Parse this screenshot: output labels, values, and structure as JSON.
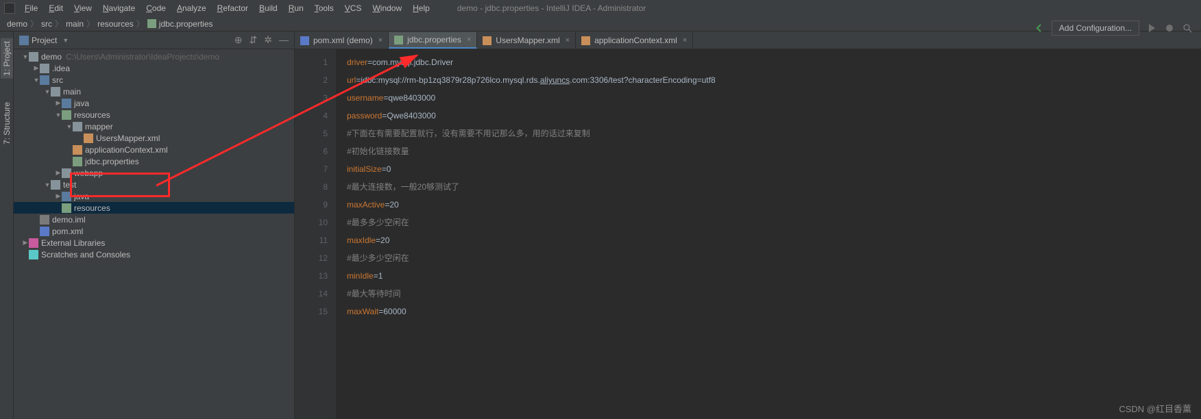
{
  "window_title": "demo - jdbc.properties - IntelliJ IDEA - Administrator",
  "menus": [
    "File",
    "Edit",
    "View",
    "Navigate",
    "Code",
    "Analyze",
    "Refactor",
    "Build",
    "Run",
    "Tools",
    "VCS",
    "Window",
    "Help"
  ],
  "breadcrumb": [
    "demo",
    "src",
    "main",
    "resources",
    "jdbc.properties"
  ],
  "config_button": "Add Configuration...",
  "panel_title": "Project",
  "side_tabs": [
    "1: Project",
    "7: Structure"
  ],
  "tree": [
    {
      "l": 0,
      "arrow": "▼",
      "icon": "folder",
      "label": "demo",
      "hint": "C:\\Users\\Administrator\\IdeaProjects\\demo"
    },
    {
      "l": 1,
      "arrow": "▶",
      "icon": "folder",
      "label": ".idea"
    },
    {
      "l": 1,
      "arrow": "▼",
      "icon": "folder-src",
      "label": "src"
    },
    {
      "l": 2,
      "arrow": "▼",
      "icon": "folder",
      "label": "main"
    },
    {
      "l": 3,
      "arrow": "▶",
      "icon": "folder-src",
      "label": "java"
    },
    {
      "l": 3,
      "arrow": "▼",
      "icon": "folder-res",
      "label": "resources"
    },
    {
      "l": 4,
      "arrow": "▼",
      "icon": "folder",
      "label": "mapper"
    },
    {
      "l": 5,
      "arrow": "",
      "icon": "file-xml",
      "label": "UsersMapper.xml"
    },
    {
      "l": 4,
      "arrow": "",
      "icon": "file-xml",
      "label": "applicationContext.xml"
    },
    {
      "l": 4,
      "arrow": "",
      "icon": "file-prop",
      "label": "jdbc.properties"
    },
    {
      "l": 3,
      "arrow": "▶",
      "icon": "folder",
      "label": "webapp"
    },
    {
      "l": 2,
      "arrow": "▼",
      "icon": "folder",
      "label": "test"
    },
    {
      "l": 3,
      "arrow": "▶",
      "icon": "folder-src",
      "label": "java"
    },
    {
      "l": 3,
      "arrow": "",
      "icon": "folder-res",
      "label": "resources",
      "selected": true
    },
    {
      "l": 1,
      "arrow": "",
      "icon": "file-iml",
      "label": "demo.iml"
    },
    {
      "l": 1,
      "arrow": "",
      "icon": "file-pom",
      "label": "pom.xml"
    },
    {
      "l": 0,
      "arrow": "▶",
      "icon": "libs",
      "label": "External Libraries"
    },
    {
      "l": 0,
      "arrow": "",
      "icon": "scratch",
      "label": "Scratches and Consoles"
    }
  ],
  "tabs": [
    {
      "icon": "file-pom",
      "label": "pom.xml (demo)"
    },
    {
      "icon": "file-prop",
      "label": "jdbc.properties",
      "active": true
    },
    {
      "icon": "file-xml",
      "label": "UsersMapper.xml"
    },
    {
      "icon": "file-xml",
      "label": "applicationContext.xml"
    }
  ],
  "code": [
    {
      "n": 1,
      "k": "driver",
      "v": "com.mysql.jdbc.Driver"
    },
    {
      "n": 2,
      "k": "url",
      "v": "jdbc:mysql://rm-bp1zq3879r28p726lco.mysql.rds.aliyuncs.com:3306/test?characterEncoding=utf8",
      "u": "aliyuncs"
    },
    {
      "n": 3,
      "k": "username",
      "v": "qwe8403000"
    },
    {
      "n": 4,
      "k": "password",
      "v": "Qwe8403000"
    },
    {
      "n": 5,
      "c": "#下面在有需要配置就行，没有需要不用记那么多，用的话过来复制"
    },
    {
      "n": 6,
      "c": "#初始化链接数量"
    },
    {
      "n": 7,
      "k": "initialSize",
      "v": "0"
    },
    {
      "n": 8,
      "c": "#最大连接数，一般20够测试了"
    },
    {
      "n": 9,
      "k": "maxActive",
      "v": "20"
    },
    {
      "n": 10,
      "c": "#最多多少空闲在"
    },
    {
      "n": 11,
      "k": "maxIdle",
      "v": "20"
    },
    {
      "n": 12,
      "c": "#最少多少空闲在"
    },
    {
      "n": 13,
      "k": "minIdle",
      "v": "1"
    },
    {
      "n": 14,
      "c": "#最大等待时间"
    },
    {
      "n": 15,
      "k": "maxWait",
      "v": "60000"
    }
  ],
  "watermark": "CSDN @红目香薰"
}
